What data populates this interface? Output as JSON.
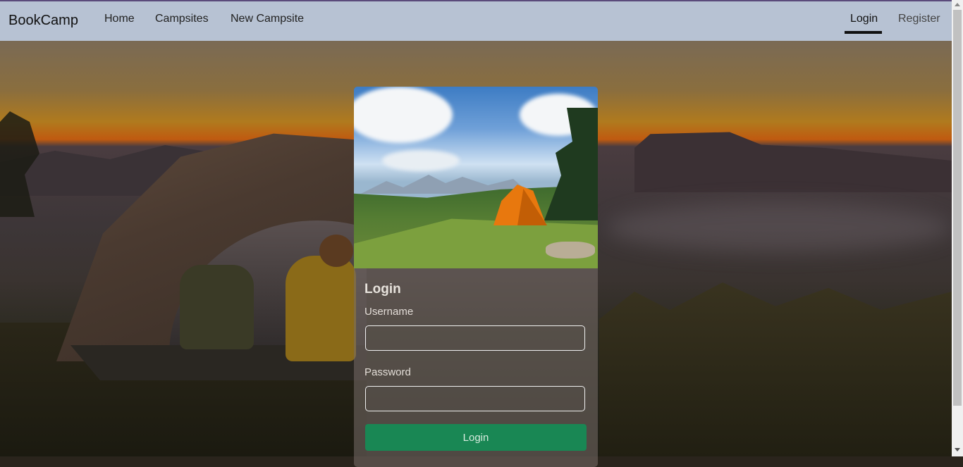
{
  "navbar": {
    "brand": "BookCamp",
    "links": [
      {
        "label": "Home"
      },
      {
        "label": "Campsites"
      },
      {
        "label": "New Campsite"
      }
    ],
    "auth": {
      "login": "Login",
      "register": "Register"
    }
  },
  "login_card": {
    "title": "Login",
    "username_label": "Username",
    "username_value": "",
    "password_label": "Password",
    "password_value": "",
    "submit_label": "Login"
  },
  "colors": {
    "navbar_bg": "#b7c2d3",
    "button_green": "#198754"
  },
  "icons": [
    "scroll-up-arrow-icon",
    "scroll-down-arrow-icon"
  ]
}
